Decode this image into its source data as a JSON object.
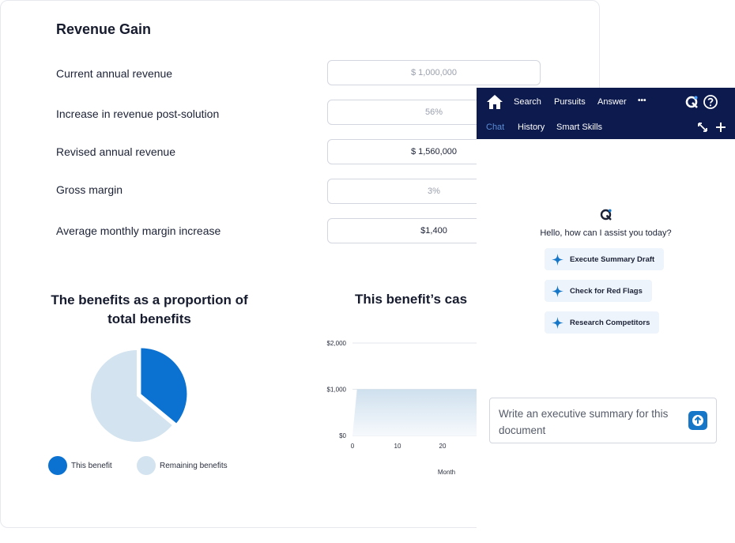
{
  "revenue": {
    "title": "Revenue Gain",
    "rows": [
      {
        "label": "Current annual revenue",
        "value": "$ 1,000,000",
        "kind": "placeholder"
      },
      {
        "label": "Increase in revenue post-solution",
        "value": "56%",
        "kind": "placeholder"
      },
      {
        "label": "Revised annual revenue",
        "value": "$ 1,560,000",
        "kind": "value"
      },
      {
        "label": "Gross margin",
        "value": "3%",
        "kind": "placeholder"
      },
      {
        "label": "Average monthly margin increase",
        "value": "$1,400",
        "kind": "value"
      }
    ]
  },
  "pie_chart": {
    "title_line1": "The benefits as a proportion of",
    "title_line2": "total benefits",
    "legend_this": "This benefit",
    "legend_remaining": "Remaining benefits"
  },
  "area_chart": {
    "title": "This benefit’s cas",
    "xlabel": "Month",
    "y_ticks": [
      "$2,000",
      "$1,000",
      "$0"
    ],
    "x_ticks": [
      "0",
      "10",
      "20"
    ]
  },
  "chart_data": [
    {
      "type": "pie",
      "title": "The benefits as a proportion of total benefits",
      "slices": [
        {
          "name": "This benefit",
          "value": 36,
          "color": "#0b72d1"
        },
        {
          "name": "Remaining benefits",
          "value": 64,
          "color": "#d3e3ef"
        }
      ]
    },
    {
      "type": "area",
      "title": "This benefit’s cas",
      "xlabel": "Month",
      "ylabel": "",
      "y_ticks": [
        0,
        1000,
        2000
      ],
      "x_ticks": [
        0,
        10,
        20
      ],
      "ylim": [
        0,
        2000
      ],
      "series": [
        {
          "x": [
            0,
            1,
            30
          ],
          "y": [
            0,
            1000,
            1000
          ]
        }
      ]
    }
  ],
  "assistant": {
    "nav": {
      "search": "Search",
      "pursuits": "Pursuits",
      "answer": "Answer",
      "more": "•••",
      "chat": "Chat",
      "history": "History",
      "smart_skills": "Smart Skills"
    },
    "greeting": "Hello, how can I assist you today?",
    "suggestions": [
      "Execute Summary Draft",
      "Check for Red Flags",
      "Research Competitors"
    ],
    "composer_text": "Write an executive summary for this document",
    "colors": {
      "topbar": "#0d1a4d",
      "accent": "#1677c9",
      "chip_bg": "#eef4fb"
    },
    "icons": [
      "home-icon",
      "logo-icon",
      "help-icon",
      "expand-icon",
      "plus-icon",
      "sparkle-icon",
      "send-icon"
    ]
  }
}
